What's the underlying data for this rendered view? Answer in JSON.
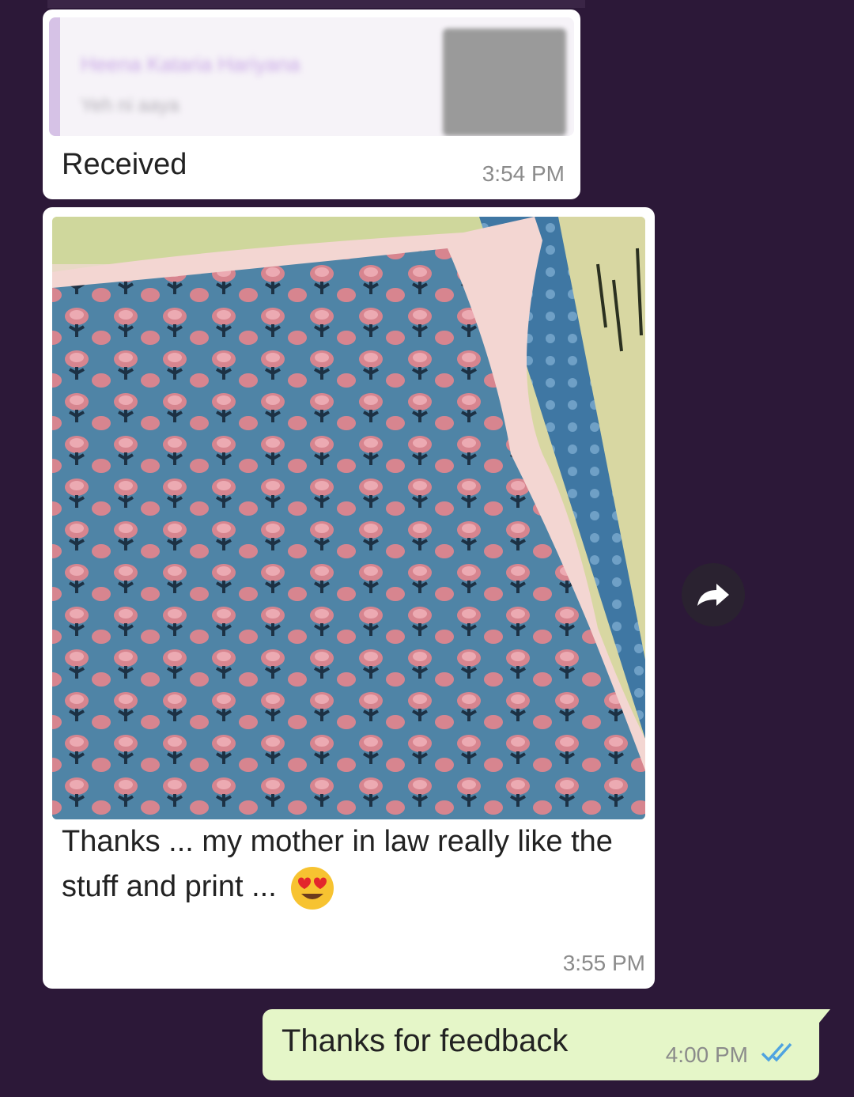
{
  "messages": [
    {
      "direction": "incoming",
      "reply_preview": {
        "sender": "Heena Kataria Hariyana",
        "snippet": "Yeh ni aaya"
      },
      "text": "Received",
      "time": "3:54 PM"
    },
    {
      "direction": "incoming",
      "has_photo": true,
      "text": "Thanks ... my mother in law really like the stuff and print ...",
      "emoji": "smiling-face-with-heart-eyes",
      "time": "3:55 PM"
    },
    {
      "direction": "outgoing",
      "text": "Thanks for feedback",
      "time": "4:00 PM",
      "status": "read",
      "status_color": "#4fa3e0"
    }
  ],
  "colors": {
    "background": "#2c1838",
    "incoming_bubble": "#ffffff",
    "outgoing_bubble": "#e5f6c8",
    "timestamp": "#8b8b8b"
  },
  "icons": {
    "forward": "forward-arrow-icon",
    "read_receipt": "double-check-icon",
    "emoji": "heart-eyes-emoji-icon"
  }
}
